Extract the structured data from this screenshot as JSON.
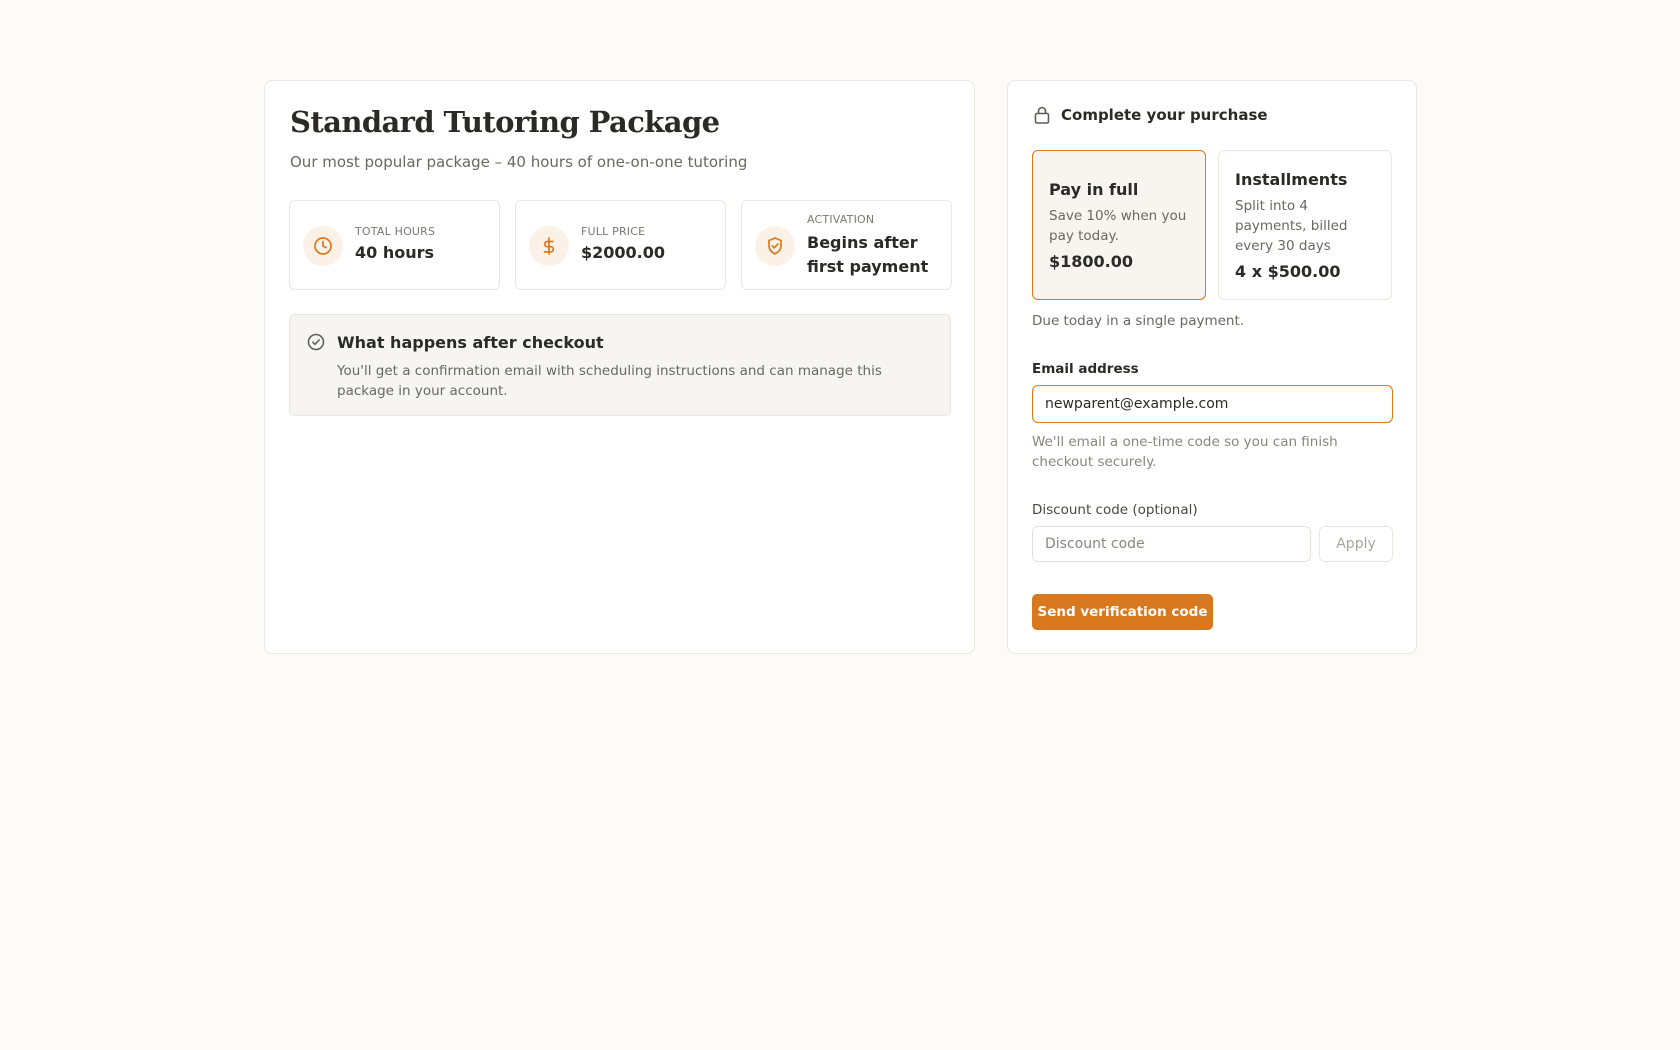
{
  "package": {
    "title": "Standard Tutoring Package",
    "subtitle": "Our most popular package – 40 hours of one-on-one tutoring",
    "stats": [
      {
        "icon": "clock-icon",
        "label": "TOTAL HOURS",
        "value": "40 hours"
      },
      {
        "icon": "dollar-icon",
        "label": "FULL PRICE",
        "value": "$2000.00"
      },
      {
        "icon": "shield-check-icon",
        "label": "ACTIVATION",
        "value": "Begins after first payment"
      }
    ],
    "info": {
      "icon": "check-circle-icon",
      "title": "What happens after checkout",
      "text": "You'll get a confirmation email with scheduling instructions and can manage this package in your account."
    }
  },
  "purchase": {
    "icon": "lock-icon",
    "title": "Complete your purchase",
    "options": [
      {
        "title": "Pay in full",
        "description": "Save 10% when you pay today.",
        "price": "$1800.00",
        "selected": true
      },
      {
        "title": "Installments",
        "description": "Split into 4 payments, billed every 30 days",
        "price": "4 x $500.00",
        "selected": false
      }
    ],
    "due_note": "Due today in a single payment.",
    "email": {
      "label": "Email address",
      "value": "newparent@example.com",
      "help": "We'll email a one-time code so you can finish checkout securely."
    },
    "discount": {
      "label": "Discount code (optional)",
      "placeholder": "Discount code",
      "apply_label": "Apply"
    },
    "submit_label": "Send verification code"
  },
  "colors": {
    "accent": "#d9791f",
    "background": "#fdfbf8",
    "info_box_bg": "#f7f5f1",
    "icon_circle_bg": "#fbf1e6"
  }
}
